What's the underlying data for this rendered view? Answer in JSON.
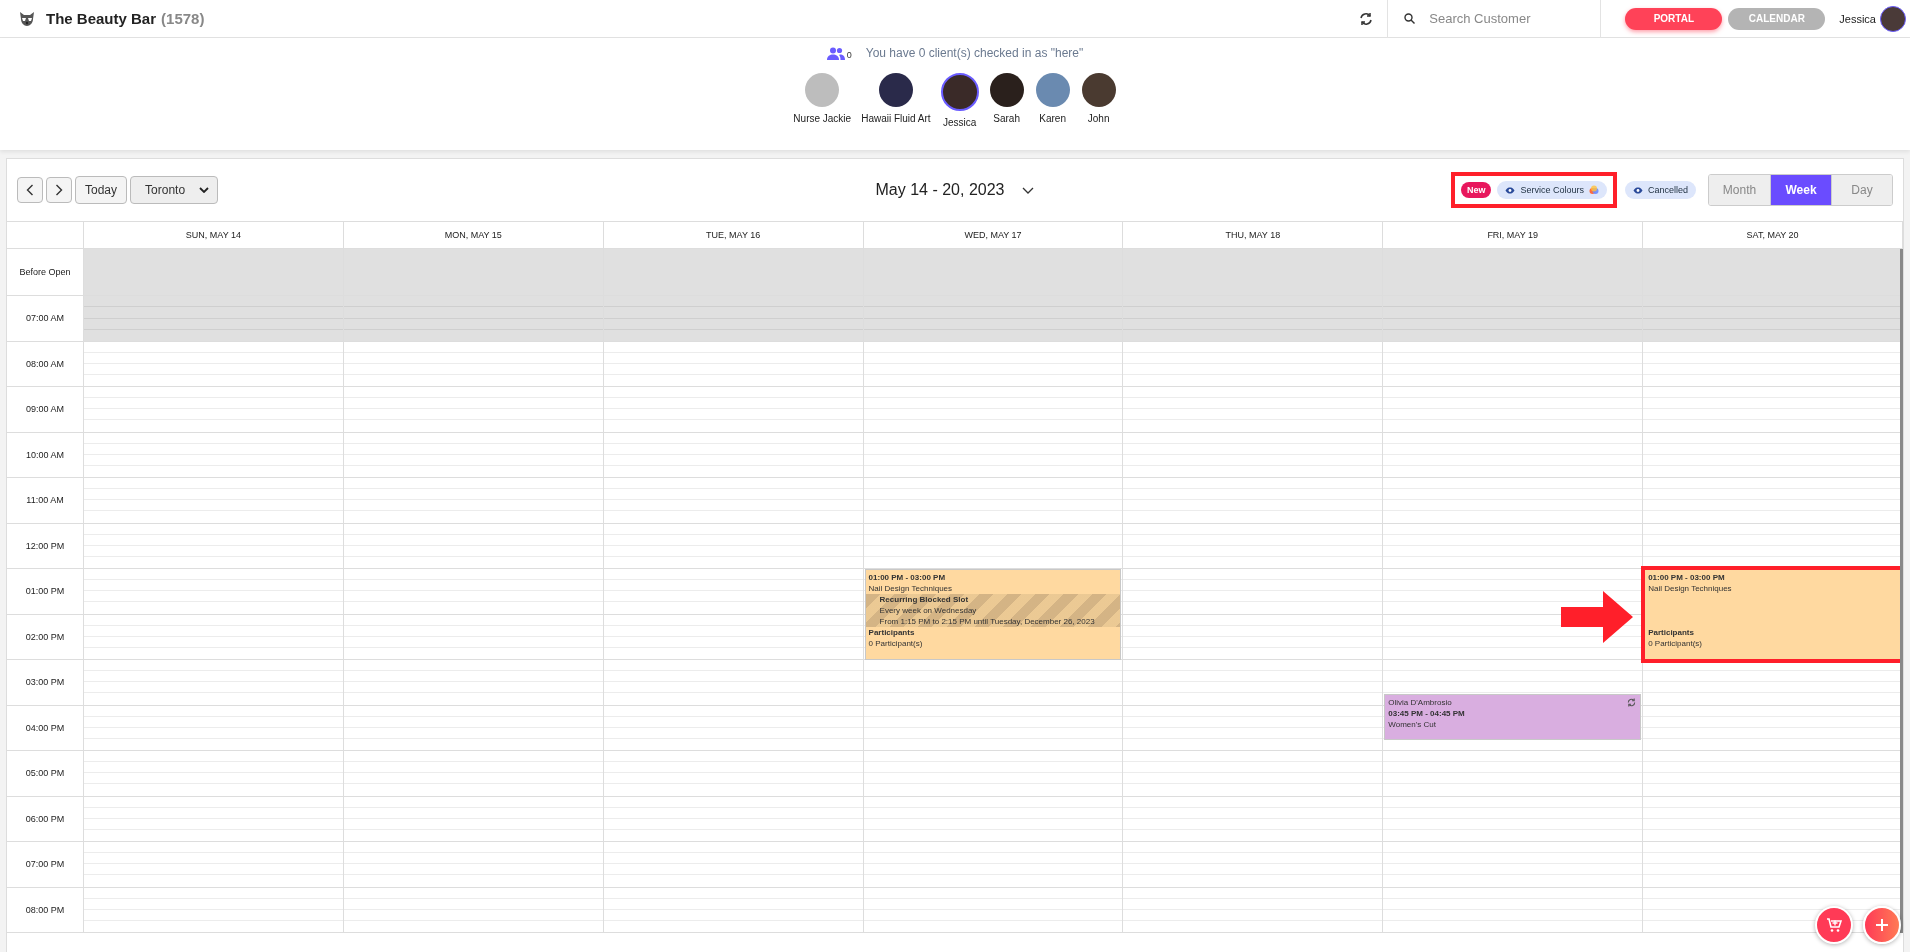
{
  "header": {
    "business": "The Beauty Bar",
    "count": "(1578)",
    "search": {
      "placeholder": "Search Customer"
    },
    "user": "Jessica",
    "nav": [
      {
        "label": "PORTAL",
        "selected": true
      },
      {
        "label": "CALENDAR",
        "selected": false
      }
    ]
  },
  "checkin": {
    "count": "0",
    "message": "You have 0 client(s) checked in as \"here\""
  },
  "staff": [
    {
      "name": "Nurse Jackie",
      "selected": false
    },
    {
      "name": "Hawaii Fluid Art",
      "selected": false
    },
    {
      "name": "Jessica",
      "selected": true
    },
    {
      "name": "Sarah",
      "selected": false
    },
    {
      "name": "Karen",
      "selected": false
    },
    {
      "name": "John",
      "selected": false
    }
  ],
  "toolbar": {
    "today": "Today",
    "location": "Toronto",
    "range": "May 14 - 20, 2023",
    "new_badge": "New",
    "highlight_frame": true,
    "filters": [
      {
        "label": "Service Colours",
        "multicolor": true
      },
      {
        "label": "Cancelled",
        "multicolor": false
      }
    ],
    "views": [
      {
        "label": "Month",
        "selected": false
      },
      {
        "label": "Week",
        "selected": true
      },
      {
        "label": "Day",
        "selected": false
      }
    ]
  },
  "time_rows": [
    {
      "label": "Before Open",
      "closed": true
    },
    {
      "label": "07:00 AM",
      "closed": true
    },
    {
      "label": "08:00 AM",
      "closed": false
    },
    {
      "label": "09:00 AM",
      "closed": false
    },
    {
      "label": "10:00 AM",
      "closed": false
    },
    {
      "label": "11:00 AM",
      "closed": false
    },
    {
      "label": "12:00 PM",
      "closed": false
    },
    {
      "label": "01:00 PM",
      "closed": false
    },
    {
      "label": "02:00 PM",
      "closed": false
    },
    {
      "label": "03:00 PM",
      "closed": false
    },
    {
      "label": "04:00 PM",
      "closed": false
    },
    {
      "label": "05:00 PM",
      "closed": false
    },
    {
      "label": "06:00 PM",
      "closed": false
    },
    {
      "label": "07:00 PM",
      "closed": false
    },
    {
      "label": "08:00 PM",
      "closed": false
    }
  ],
  "days": [
    {
      "label": "SUN, MAY 14"
    },
    {
      "label": "MON, MAY 15"
    },
    {
      "label": "TUE, MAY 16"
    },
    {
      "label": "WED, MAY 17",
      "events": [
        {
          "kind": "class",
          "time": "01:00 PM - 03:00 PM",
          "title": "Nail Design Techniques",
          "section": "Participants",
          "participants": "0 Participant(s)",
          "color": "#ffd9a0",
          "highlighted": false,
          "blocked": {
            "title": "Recurring Blocked Slot",
            "recurrence": "Every week on Wednesday",
            "range": "From 1:15 PM to 2:15 PM until Tuesday, December 26, 2023"
          }
        }
      ]
    },
    {
      "label": "THU, MAY 18"
    },
    {
      "label": "FRI, MAY 19",
      "events": [
        {
          "kind": "appointment",
          "client": "Olivia D'Ambrosio",
          "time": "03:45 PM - 04:45 PM",
          "title": "Women's Cut",
          "recurring": true,
          "color": "#d9aee0",
          "highlighted": false
        }
      ]
    },
    {
      "label": "SAT, MAY 20",
      "events": [
        {
          "kind": "class",
          "time": "01:00 PM - 03:00 PM",
          "title": "Nail Design Techniques",
          "section": "Participants",
          "participants": "0 Participant(s)",
          "color": "#ffd9a0",
          "highlighted": true
        }
      ]
    }
  ],
  "annotation_arrow": true
}
